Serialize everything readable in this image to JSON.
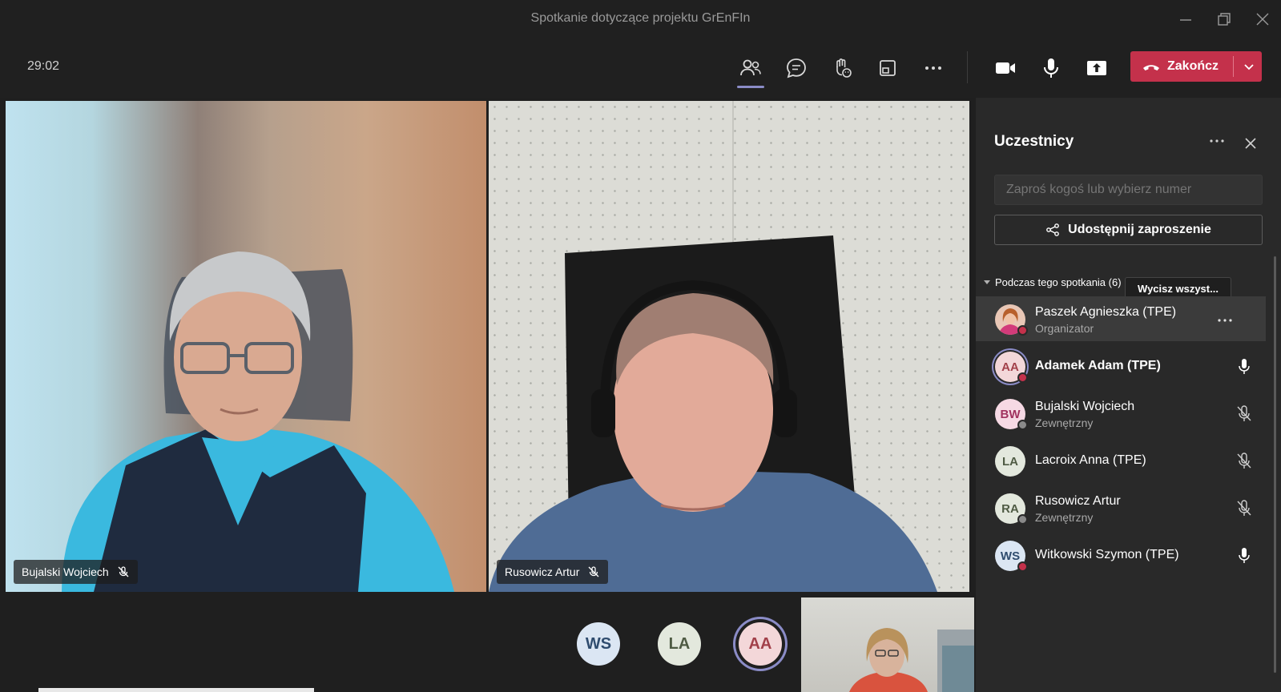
{
  "window": {
    "title": "Spotkanie dotyczące projektu GrEnFIn"
  },
  "toolbar": {
    "timer": "29:02",
    "end_label": "Zakończ"
  },
  "tiles": [
    {
      "name": "Bujalski Wojciech"
    },
    {
      "name": "Rusowicz Artur"
    }
  ],
  "strip": {
    "avatars": [
      {
        "initials": "WS",
        "bg": "#dbe6f3",
        "fg": "#2f4c6e"
      },
      {
        "initials": "LA",
        "bg": "#e3e8dd",
        "fg": "#4f5b44"
      },
      {
        "initials": "AA",
        "bg": "#f3d7d9",
        "fg": "#a2404a"
      }
    ]
  },
  "panel": {
    "title": "Uczestnicy",
    "invite_placeholder": "Zaproś kogoś lub wybierz numer",
    "share_label": "Udostępnij zaproszenie",
    "section_label": "Podczas tego spotkania (6)",
    "clear_label": "Wycisz wszyst...",
    "participants": [
      {
        "name": "Paszek Agnieszka (TPE)",
        "role": "Organizator",
        "initials": "",
        "mic": "none"
      },
      {
        "name": "Adamek Adam (TPE)",
        "role": "",
        "initials": "AA",
        "mic": "on"
      },
      {
        "name": "Bujalski Wojciech",
        "role": "Zewnętrzny",
        "initials": "BW",
        "mic": "off"
      },
      {
        "name": "Lacroix Anna (TPE)",
        "role": "",
        "initials": "LA",
        "mic": "off"
      },
      {
        "name": "Rusowicz Artur",
        "role": "Zewnętrzny",
        "initials": "RA",
        "mic": "off"
      },
      {
        "name": "Witkowski Szymon (TPE)",
        "role": "",
        "initials": "WS",
        "mic": "on"
      }
    ]
  },
  "colors": {
    "accent": "#8b8cc7",
    "end_red": "#c4314b",
    "presence_busy": "#c4314b"
  }
}
